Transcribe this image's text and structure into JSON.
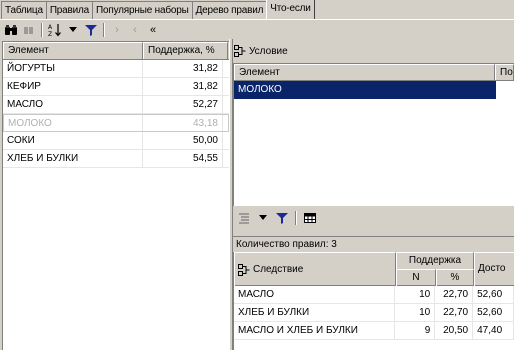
{
  "tabs": [
    {
      "label": "Таблица",
      "active": false
    },
    {
      "label": "Правила",
      "active": false
    },
    {
      "label": "Популярные наборы",
      "active": false
    },
    {
      "label": "Дерево правил",
      "active": false
    },
    {
      "label": "Что-если",
      "active": true
    }
  ],
  "left_toolbar": {
    "icons": [
      "binoculars-icon",
      "find-next-icon",
      "sort-icon",
      "dropdown-arrow-icon",
      "filter-icon",
      "collapse-icon",
      "expand-icon",
      "double-left-icon"
    ]
  },
  "elements_table": {
    "headers": [
      "Элемент",
      "Поддержка, %"
    ],
    "rows": [
      {
        "element": "ЙОГУРТЫ",
        "support": "31,82",
        "dim": false
      },
      {
        "element": "КЕФИР",
        "support": "31,82",
        "dim": false
      },
      {
        "element": "МАСЛО",
        "support": "52,27",
        "dim": false
      },
      {
        "element": "МОЛОКО",
        "support": "43,18",
        "dim": true
      },
      {
        "element": "СОКИ",
        "support": "50,00",
        "dim": false
      },
      {
        "element": "ХЛЕБ И БУЛКИ",
        "support": "54,55",
        "dim": false
      }
    ]
  },
  "condition": {
    "title": "Условие",
    "headers": [
      "Элемент",
      "По"
    ],
    "selected_value": "МОЛОКО"
  },
  "right_toolbar": {
    "icons": [
      "list-icon",
      "dropdown-arrow-icon",
      "filter-icon",
      "table-icon"
    ]
  },
  "results": {
    "count_label": "Количество правил: 3",
    "consequence_header": "Следствие",
    "support_group_header": "Поддержка",
    "n_header": "N",
    "pct_header": "%",
    "confidence_header": "Досто",
    "rows": [
      {
        "consequence": "МАСЛО",
        "n": "10",
        "pct": "22,70",
        "conf": "52,60"
      },
      {
        "consequence": "ХЛЕБ И БУЛКИ",
        "n": "10",
        "pct": "22,70",
        "conf": "52,60"
      },
      {
        "consequence": "МАСЛО И ХЛЕБ И БУЛКИ",
        "n": "9",
        "pct": "20,50",
        "conf": "47,40"
      }
    ]
  }
}
